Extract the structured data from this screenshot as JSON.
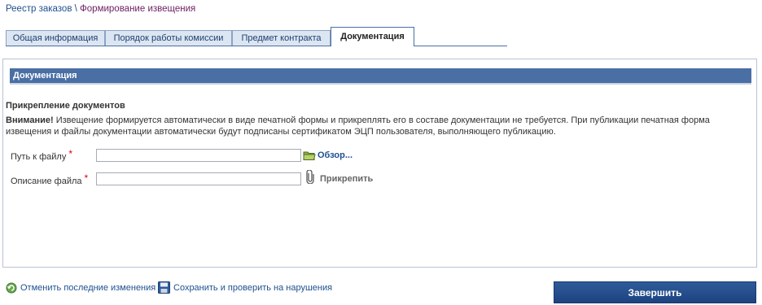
{
  "breadcrumb": {
    "parent": "Реестр заказов",
    "separator": "\\",
    "current": "Формирование извещения"
  },
  "tabs": [
    {
      "label": "Общая информация",
      "active": false
    },
    {
      "label": "Порядок работы комиссии",
      "active": false
    },
    {
      "label": "Предмет контракта",
      "active": false
    },
    {
      "label": "Документация",
      "active": true
    }
  ],
  "section": {
    "title": "Документация",
    "subheading": "Прикрепление документов",
    "notice_bold": "Внимание!",
    "notice_text": "Извещение формируется автоматически в виде печатной формы и прикреплять его в составе документации не требуется. При публикации печатная форма извещения и файлы документации автоматически будут подписаны сертификатом ЭЦП пользователя, выполняющего публикацию."
  },
  "form": {
    "file_path_label": "Путь к файлу",
    "file_path_value": "",
    "browse_label": "Обзор...",
    "description_label": "Описание файла",
    "description_value": "",
    "attach_label": "Прикрепить",
    "required_marker": "*"
  },
  "footer": {
    "undo_label": "Отменить последние изменения",
    "save_label": "Сохранить и проверить на нарушения",
    "finish_label": "Завершить"
  },
  "colors": {
    "section_bar": "#4a6fa5",
    "link": "#1f4f8f",
    "breadcrumb_current": "#6d1e63",
    "required": "#dd0000",
    "finish_button": "#1d4380"
  }
}
